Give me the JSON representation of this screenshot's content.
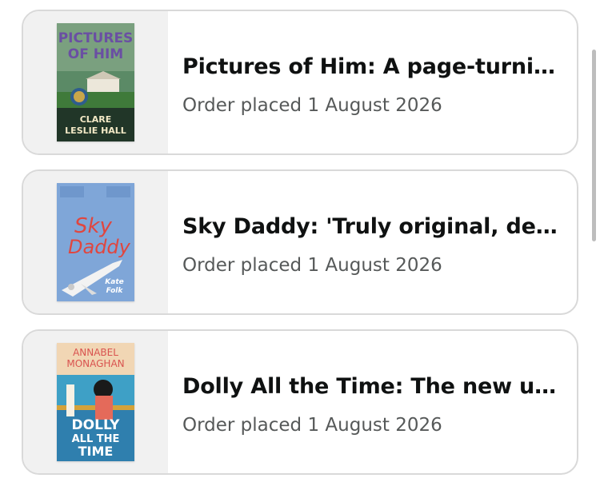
{
  "orders": [
    {
      "title": "Pictures of Him: A page-turning…",
      "status": "Order placed 1 August 2026",
      "cover": {
        "top_text": "PICTURES",
        "top_text2": "OF HIM",
        "author_line1": "CLARE",
        "author_line2": "LESLIE HALL",
        "colors": {
          "sky": "#5a8a5c",
          "title": "#6a4fa3",
          "house": "#e9e4d6",
          "lawn": "#3f7a3a",
          "band": "#233a2a",
          "author": "#f3e9c6"
        }
      }
    },
    {
      "title": "Sky Daddy: 'Truly original, deep…",
      "status": "Order placed 1 August 2026",
      "cover": {
        "title_line1": "Sky",
        "title_line2": "Daddy",
        "author_line1": "Kate",
        "author_line2": "Folk",
        "colors": {
          "sky": "#7da4d6",
          "title": "#e0463f",
          "plane": "#f2f2f2"
        }
      }
    },
    {
      "title": "Dolly All the Time: The new un…",
      "status": "Order placed 1 August 2026",
      "cover": {
        "author_line1": "ANNABEL",
        "author_line2": "MONAGHAN",
        "title_line1": "DOLLY",
        "title_line2": "ALL THE",
        "title_line3": "TIME",
        "colors": {
          "top": "#f4d7b2",
          "author": "#d9534f",
          "sea": "#3ea0c6",
          "rail": "#d4a23a",
          "title": "#ffffff"
        }
      }
    }
  ]
}
